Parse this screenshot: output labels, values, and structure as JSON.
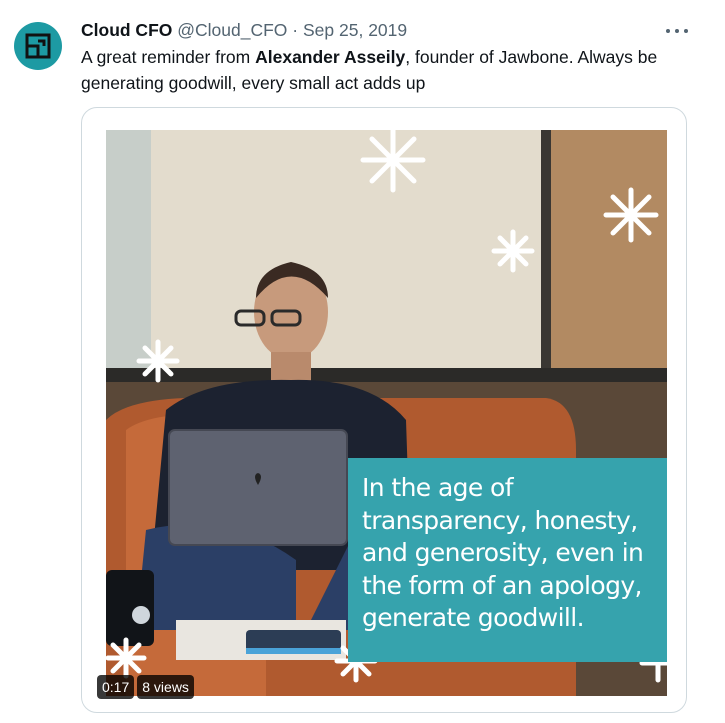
{
  "tweet": {
    "author_name": "Cloud CFO",
    "handle": "@Cloud_CFO",
    "separator": "·",
    "date": "Sep 25, 2019",
    "text_part1": "A great reminder from ",
    "text_bold": "Alexander Asseily",
    "text_part2": ", founder of Jawbone. Always be generating goodwill, every small act adds up",
    "more_icon": "more-horizontal-icon",
    "avatar_icon": "cloud-cfo-logo"
  },
  "media": {
    "quote_lines": [
      "In the age of",
      "transparency, honesty,",
      "and generosity, even in",
      "the form of an apology,",
      "generate goodwill."
    ],
    "time": "0:17",
    "views": "8 views"
  },
  "colors": {
    "brand_teal": "#1d9aa3",
    "quote_box": "#36a3ad",
    "text_primary": "#0f1419",
    "text_secondary": "#536471",
    "border": "#cfd9de"
  }
}
